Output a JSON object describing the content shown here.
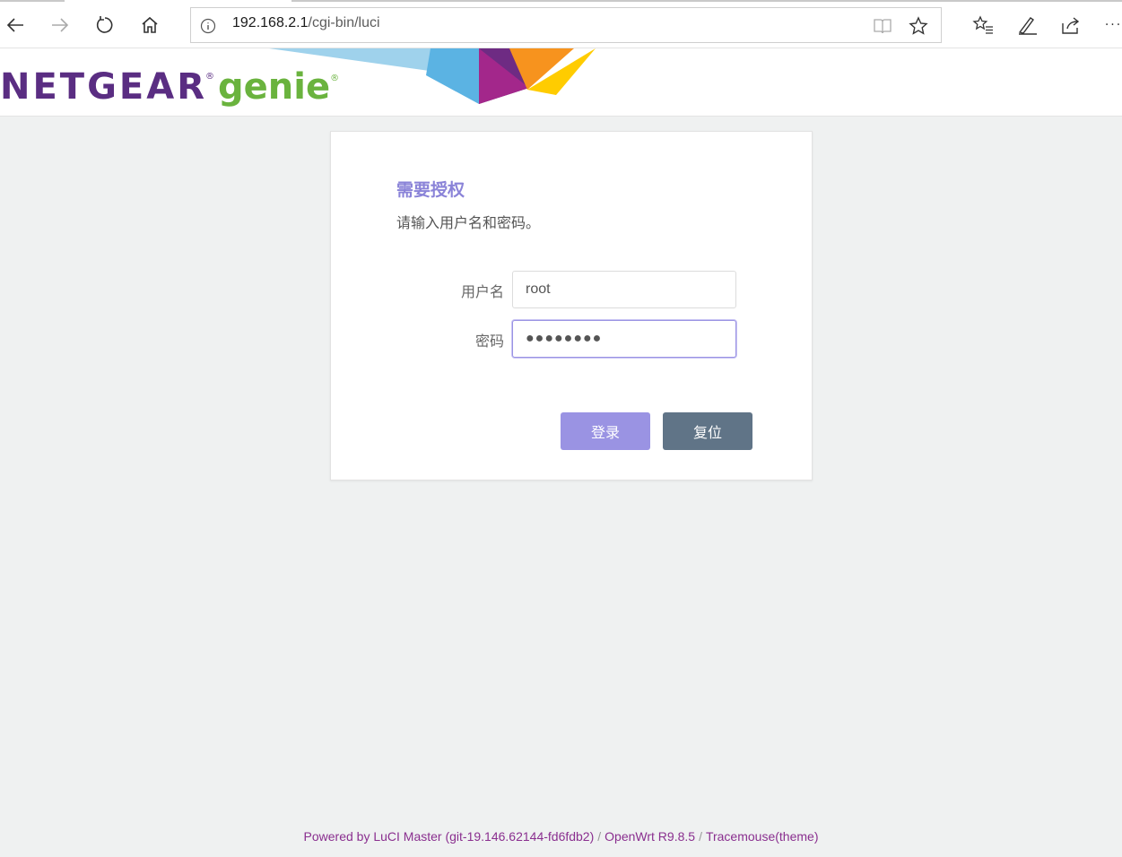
{
  "browser": {
    "url_host": "192.168.2.1",
    "url_path": "/cgi-bin/luci",
    "icons": [
      "back-icon",
      "forward-icon",
      "refresh-icon",
      "home-icon",
      "info-icon",
      "reading-view-icon",
      "favorite-star-icon",
      "favorites-list-icon",
      "pen-icon",
      "share-icon",
      "more-icon"
    ],
    "more_label": "···"
  },
  "header": {
    "brand_main": "NETGEAR",
    "brand_reg": "®",
    "brand_sub": "genie",
    "brand_sub_reg": "®",
    "colors": {
      "netgear": "#5a2d82",
      "genie": "#6ab33e"
    }
  },
  "login": {
    "title": "需要授权",
    "description": "请输入用户名和密码。",
    "username_label": "用户名",
    "username_value": "root",
    "password_label": "密码",
    "password_value": "●●●●●●●●",
    "login_button": "登录",
    "reset_button": "复位",
    "colors": {
      "accent": "#9a93e3",
      "reset": "#607487"
    }
  },
  "footer": {
    "powered": "Powered by LuCI Master (git-19.146.62144-fd6fdb2)",
    "sep1": "/",
    "openwrt": "OpenWrt R9.8.5",
    "sep2": "/",
    "theme": "Tracemouse(theme)"
  }
}
